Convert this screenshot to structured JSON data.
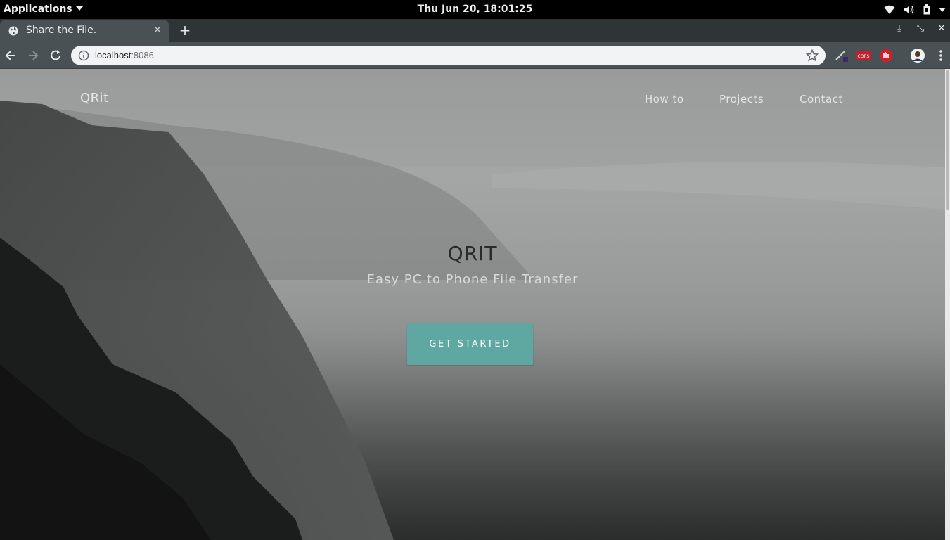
{
  "system_bar": {
    "applications_label": "Applications",
    "clock": "Thu Jun 20, 18:01:25",
    "tray_icons": [
      "wifi-icon",
      "volume-icon",
      "battery-icon",
      "system-menu-caret-icon"
    ]
  },
  "browser": {
    "tab": {
      "title": "Share the File.",
      "favicon": "globe-icon"
    },
    "new_tab_symbol": "+",
    "window_controls": [
      "minimize-icon",
      "restore-icon",
      "close-icon"
    ],
    "address": {
      "host": "localhost",
      "port": ":8086"
    },
    "extensions": [
      "pen-extension-icon",
      "cors-extension-icon",
      "stop-hand-extension-icon",
      "profile-avatar",
      "menu-icon"
    ],
    "extension_cors_label": "CORS"
  },
  "site": {
    "brand": "QRit",
    "nav": [
      "How to",
      "Projects",
      "Contact"
    ],
    "hero": {
      "title": "QRIT",
      "subtitle": "Easy PC to Phone File Transfer",
      "cta": "GET STARTED"
    },
    "accent_color": "#5fa8a2"
  }
}
